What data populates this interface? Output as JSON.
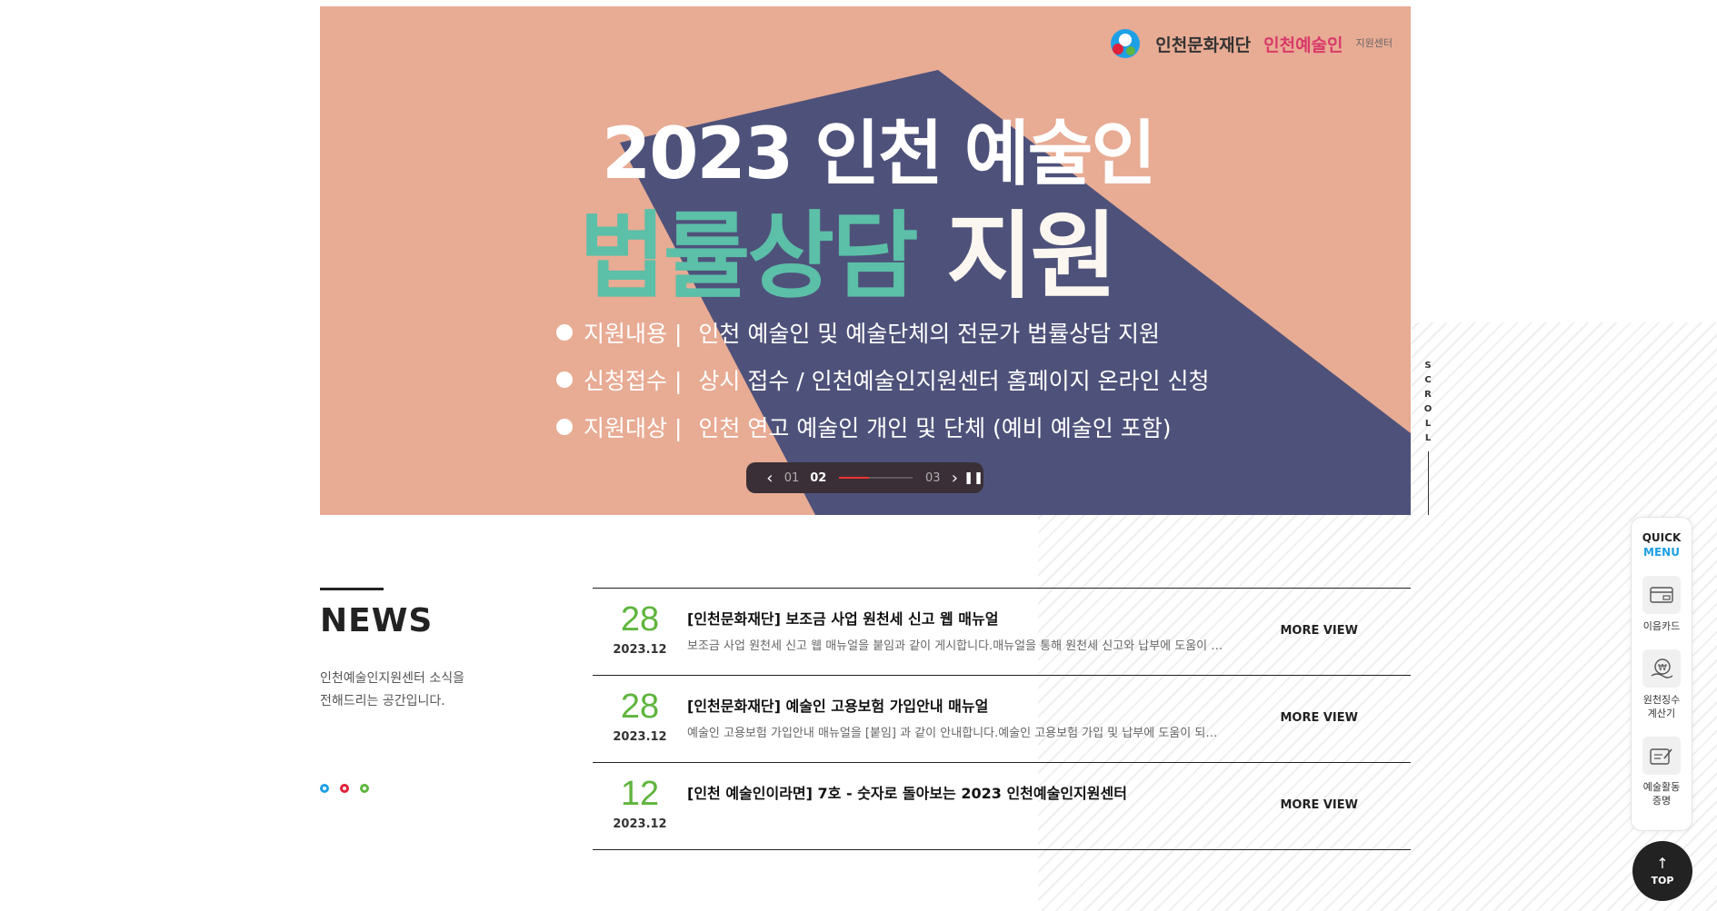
{
  "banner": {
    "logo1_text": "인천문화재단",
    "logo2_text": "인천예술인",
    "logo2_sub": "지원센터",
    "title_line1": "2023 인천 예술인",
    "title_green": "법률상담",
    "title_white": "지원",
    "lines": [
      {
        "label": "지원내용 |",
        "text": "인천 예술인 및 예술단체의 전문가 법률상담 지원"
      },
      {
        "label": "신청접수 |",
        "text": "상시 접수 / 인천예술인지원센터 홈페이지 온라인 신청"
      },
      {
        "label": "지원대상 |",
        "text": "인천 연고 예술인 개인 및 단체 (예비 예술인 포함)"
      }
    ],
    "slider": {
      "prev": "01",
      "current": "02",
      "next": "03",
      "progress": 0.4
    },
    "colors": {
      "background": "#e8ab94",
      "shape": "#4e527a",
      "accent": "#5cbfa8"
    }
  },
  "scroll_indicator": "SCROLL",
  "news": {
    "title": "NEWS",
    "description_line1": "인천예술인지원센터 소식을",
    "description_line2": "전해드리는 공간입니다.",
    "dot_colors": [
      "#1ea0e6",
      "#e0213a",
      "#5fb53e"
    ],
    "items": [
      {
        "day": "28",
        "date": "2023.12",
        "title": "[인천문화재단] 보조금 사업 원천세 신고 웹 매뉴얼",
        "summary": "보조금 사업 원천세 신고 웹 매뉴얼을 붙임과 같이 게시합니다.매뉴얼을 통해 원천세 신고와 납부에 도움이 …",
        "more": "MORE VIEW"
      },
      {
        "day": "28",
        "date": "2023.12",
        "title": "[인천문화재단] 예술인 고용보험 가입안내 매뉴얼",
        "summary": "예술인 고용보험 가입안내 매뉴얼을 [붙임] 과 같이 안내합니다.예술인 고용보험 가입 및 납부에 도움이 되…",
        "more": "MORE VIEW"
      },
      {
        "day": "12",
        "date": "2023.12",
        "title": "[인천 예술인이라면] 7호 - 숫자로 돌아보는 2023 인천예술인지원센터",
        "summary": "",
        "more": "MORE VIEW"
      }
    ]
  },
  "quick_menu": {
    "title_top": "QUICK",
    "title_bottom": "MENU",
    "items": [
      {
        "label": "이음카드",
        "icon": "card-icon"
      },
      {
        "label_line1": "원천징수",
        "label_line2": "계산기",
        "icon": "calculator-icon"
      },
      {
        "label_line1": "예술활동",
        "label_line2": "증명",
        "icon": "certificate-icon"
      }
    ]
  },
  "top_button": "TOP"
}
